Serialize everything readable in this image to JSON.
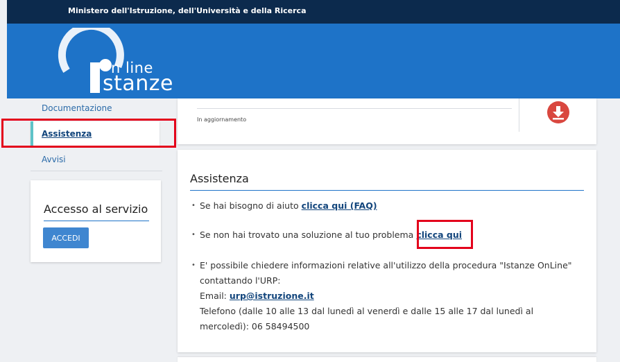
{
  "topbar": {
    "ministry": "Ministero dell'Istruzione, dell'Università e della Ricerca"
  },
  "logo": {
    "online": "n line",
    "istanze": "stanze"
  },
  "sidebar": {
    "items": [
      {
        "label": "Documentazione"
      },
      {
        "label": "Assistenza"
      },
      {
        "label": "Avvisi"
      }
    ]
  },
  "access": {
    "title": "Accesso al servizio",
    "button": "ACCEDI"
  },
  "top_card": {
    "status": "In aggiornamento",
    "icon": "download-icon"
  },
  "assistenza": {
    "title": "Assistenza",
    "faq_text": "Se hai bisogno di aiuto",
    "faq_link": "clicca qui (FAQ)",
    "problem_text": "Se non hai trovato una soluzione al tuo problema",
    "problem_link": "clicca qui",
    "info_line1": "E' possibile chiedere informazioni relative all'utilizzo della procedura \"Istanze OnLine\"",
    "info_line2": "contattando l'URP:",
    "email_label": "Email:",
    "email_link": "urp@istruzione.it",
    "phone_line1": "Telefono (dalle 10 alle 13 dal lunedì al venerdì e dalle 15 alle 17 dal lunedì al",
    "phone_line2": "mercoledì): 06 58494500"
  },
  "colors": {
    "header_blue": "#1e73c8",
    "topbar_navy": "#0c2a4d",
    "link_blue": "#12457c",
    "highlight_red": "#e3001b",
    "download_red": "#d9473f",
    "active_accent": "#5fc3c8"
  }
}
